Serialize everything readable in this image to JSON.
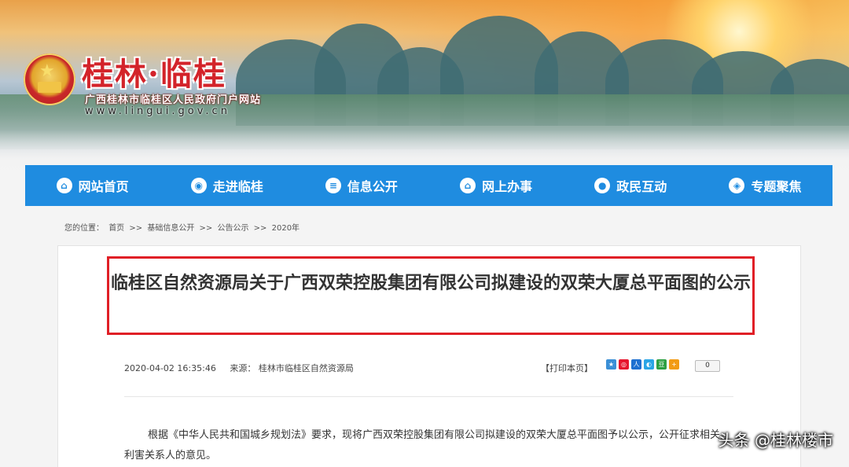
{
  "header": {
    "site_title": "桂林·临桂",
    "site_subtitle": "广西桂林市临桂区人民政府门户网站",
    "site_url": "www.lingui.gov.cn"
  },
  "nav": {
    "items": [
      {
        "label": "网站首页",
        "icon": "home-icon"
      },
      {
        "label": "走进临桂",
        "icon": "intro-icon"
      },
      {
        "label": "信息公开",
        "icon": "info-icon"
      },
      {
        "label": "网上办事",
        "icon": "service-icon"
      },
      {
        "label": "政民互动",
        "icon": "interaction-icon"
      },
      {
        "label": "专题聚焦",
        "icon": "topic-icon"
      }
    ]
  },
  "breadcrumb": {
    "prefix": "您的位置：",
    "items": [
      "首页",
      "基础信息公开",
      "公告公示",
      "2020年"
    ],
    "separator": ">>"
  },
  "article": {
    "title": "临桂区自然资源局关于广西双荣控股集团有限公司拟建设的双荣大厦总平面图的公示",
    "date": "2020-04-02 16:35:46",
    "source_label": "来源：",
    "source": "桂林市临桂区自然资源局",
    "print_label": "【打印本页】",
    "share_count": "0",
    "body": "根据《中华人民共和国城乡规划法》要求，现将广西双荣控股集团有限公司拟建设的双荣大厦总平面图予以公示，公开征求相关利害关系人的意见。"
  },
  "watermark": "头条 @桂林楼市",
  "colors": {
    "nav": "#1f8ce0",
    "title_box": "#e01f26",
    "site_title": "#d3232a"
  }
}
